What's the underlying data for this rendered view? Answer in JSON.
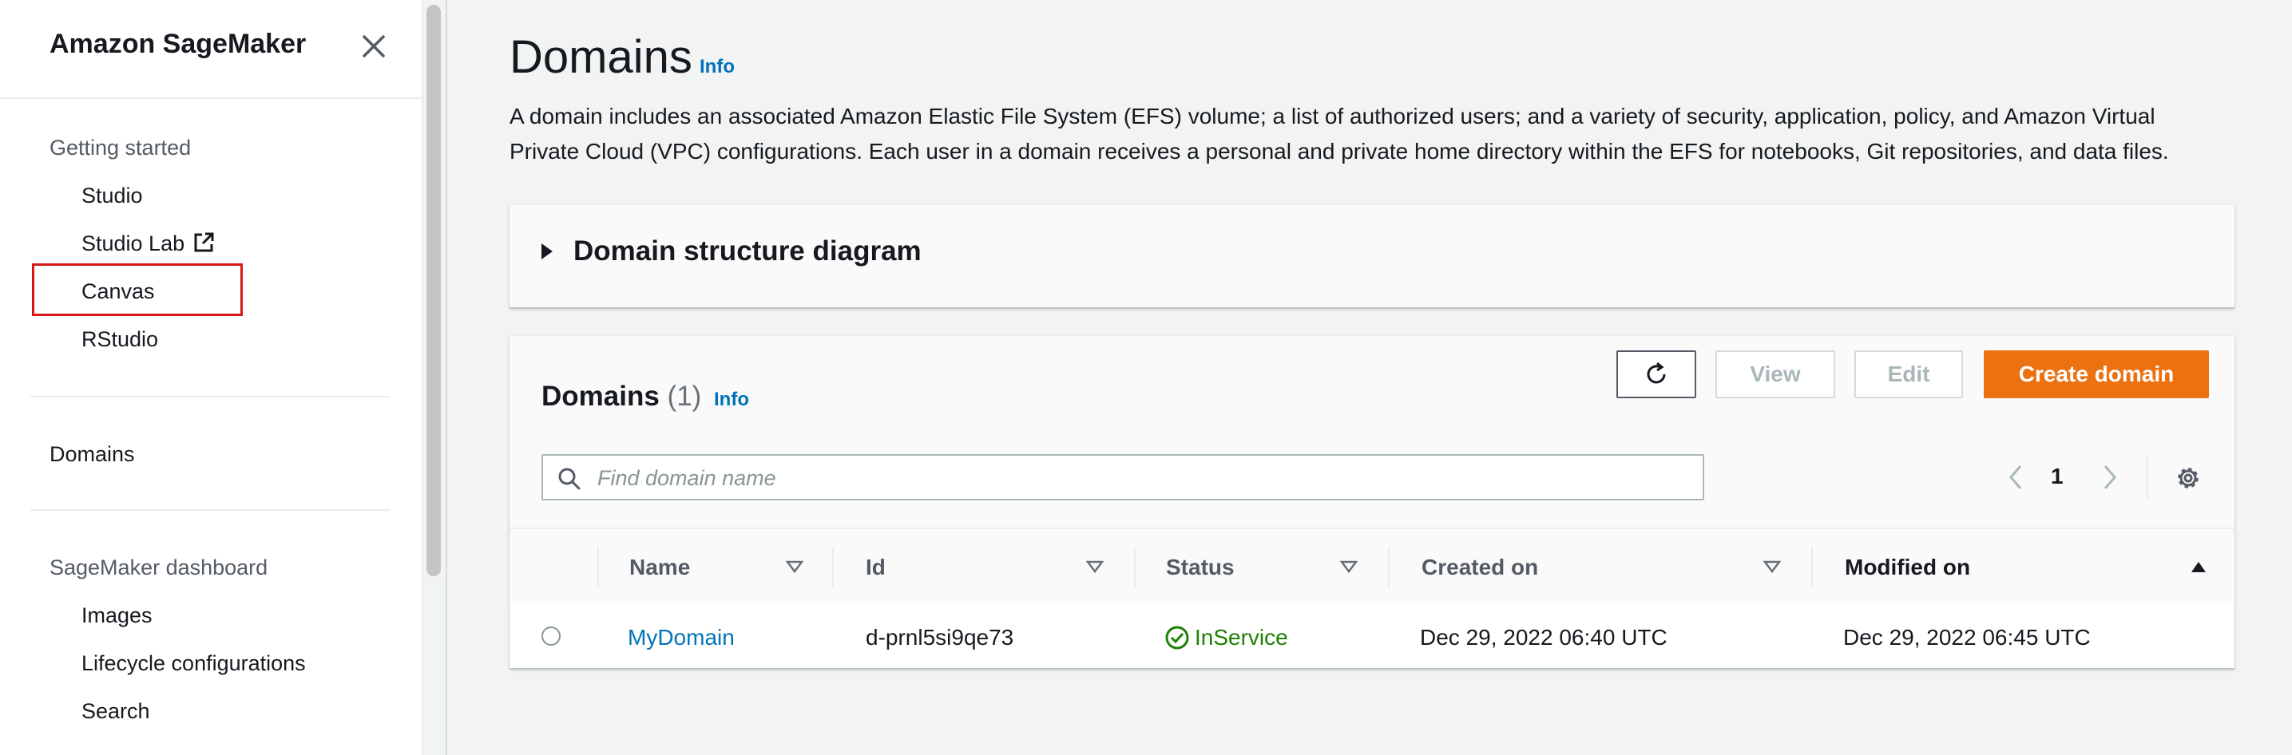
{
  "sidebar": {
    "title": "Amazon SageMaker",
    "sections": [
      {
        "title": "Getting started",
        "items": [
          {
            "label": "Studio"
          },
          {
            "label": "Studio Lab",
            "icon": "external-link-icon"
          },
          {
            "label": "Canvas"
          },
          {
            "label": "RStudio"
          }
        ]
      },
      {
        "title": "Domains",
        "items": []
      },
      {
        "title": "SageMaker dashboard",
        "items": [
          {
            "label": "Images"
          },
          {
            "label": "Lifecycle configurations"
          },
          {
            "label": "Search"
          }
        ]
      }
    ]
  },
  "page": {
    "title": "Domains",
    "info": "Info",
    "description": "A domain includes an associated Amazon Elastic File System (EFS) volume; a list of authorized users; and a variety of security, application, policy, and Amazon Virtual Private Cloud (VPC) configurations. Each user in a domain receives a personal and private home directory within the EFS for notebooks, Git repositories, and data files."
  },
  "diagram_panel": {
    "title": "Domain structure diagram"
  },
  "domains_panel": {
    "title": "Domains",
    "count": "(1)",
    "info": "Info",
    "buttons": {
      "view": "View",
      "edit": "Edit",
      "create": "Create domain"
    },
    "search": {
      "placeholder": "Find domain name",
      "value": ""
    },
    "pagination": {
      "current_page": "1"
    },
    "columns": [
      "Name",
      "Id",
      "Status",
      "Created on",
      "Modified on"
    ],
    "rows": [
      {
        "name": "MyDomain",
        "id": "d-prnl5si9qe73",
        "status": "InService",
        "created_on": "Dec 29, 2022 06:40 UTC",
        "modified_on": "Dec 29, 2022 06:45 UTC"
      }
    ]
  },
  "colors": {
    "accent": "#ec7211",
    "link": "#0073bb",
    "success": "#1d8102",
    "highlight": "#d91515"
  }
}
